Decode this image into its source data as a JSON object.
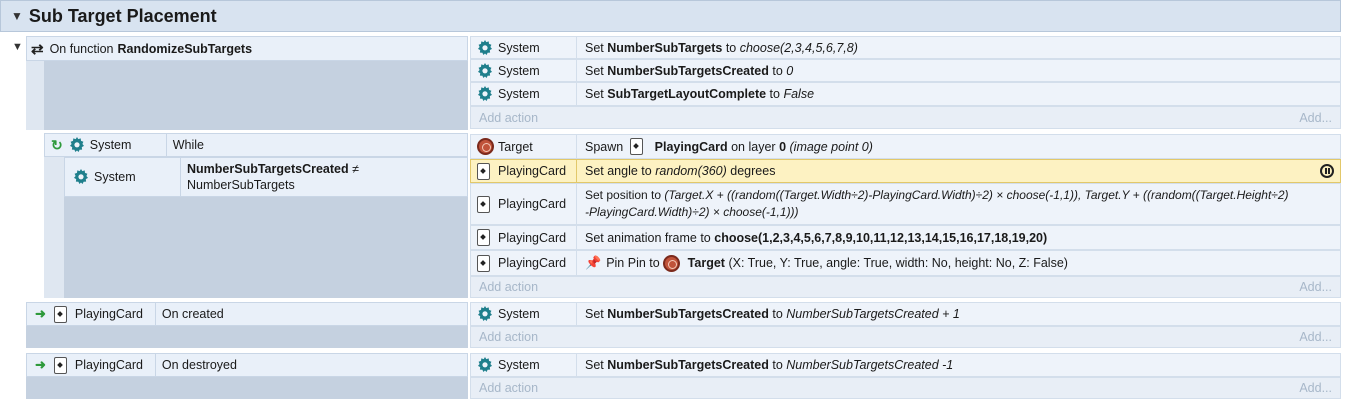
{
  "group": {
    "title": "Sub Target Placement"
  },
  "ev1": {
    "trigger_prefix": "On function",
    "trigger_name": "RandomizeSubTargets",
    "actions": [
      {
        "object": "System",
        "verb": "Set",
        "var": "NumberSubTargets",
        "to": "to",
        "value": "choose(2,3,4,5,6,7,8)"
      },
      {
        "object": "System",
        "verb": "Set",
        "var": "NumberSubTargetsCreated",
        "to": "to",
        "value": "0"
      },
      {
        "object": "System",
        "verb": "Set",
        "var": "SubTargetLayoutComplete",
        "to": "to",
        "value": "False"
      }
    ]
  },
  "ev2": {
    "cond1": {
      "object": "System",
      "text": "While"
    },
    "cond2": {
      "object": "System",
      "line1": "NumberSubTargetsCreated",
      "op": "≠",
      "line2": "NumberSubTargets"
    },
    "a1": {
      "object": "Target",
      "spawn": "Spawn",
      "card": "PlayingCard",
      "layer_txt": "on layer",
      "layer": "0",
      "point": "(image point 0)"
    },
    "a2": {
      "object": "PlayingCard",
      "t1": "Set angle to",
      "expr": "random(360)",
      "t2": "degrees"
    },
    "a3": {
      "object": "PlayingCard",
      "t1": "Set position to",
      "line1": "(Target.X + ((random((Target.Width÷2)-PlayingCard.Width)÷2) × choose(-1,1)), Target.Y + ((random((Target.Height÷2)",
      "line2": "-PlayingCard.Width)÷2) × choose(-1,1)))"
    },
    "a4": {
      "object": "PlayingCard",
      "t1": "Set animation frame to",
      "expr": "choose(1,2,3,4,5,6,7,8,9,10,11,12,13,14,15,16,17,18,19,20)"
    },
    "a5": {
      "object": "PlayingCard",
      "t1": "Pin Pin to",
      "target": "Target",
      "params": "(X: True, Y: True, angle: True, width: No, height: No, Z: False)"
    }
  },
  "ev3": {
    "object": "PlayingCard",
    "trigger": "On created",
    "action": {
      "object": "System",
      "verb": "Set",
      "var": "NumberSubTargetsCreated",
      "to": "to",
      "value": "NumberSubTargetsCreated + 1"
    }
  },
  "ev4": {
    "object": "PlayingCard",
    "trigger": "On destroyed",
    "action": {
      "object": "System",
      "verb": "Set",
      "var": "NumberSubTargetsCreated",
      "to": "to",
      "value": "NumberSubTargetsCreated -1"
    }
  },
  "add_action": "Add action",
  "add": "Add...",
  "colors": {
    "gear": "#1f7f8c",
    "accent_green": "#2e9a3b",
    "selected": "#fdf2c2"
  }
}
